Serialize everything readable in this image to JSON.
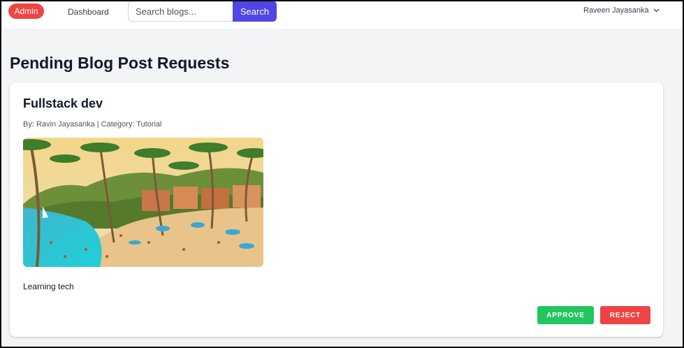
{
  "navbar": {
    "admin_badge": "Admin",
    "dashboard_link": "Dashboard",
    "search": {
      "placeholder": "Search blogs...",
      "value": "",
      "button_label": "Search"
    },
    "user_name": "Raveen Jayasanka",
    "user_menu_icon": "chevron-down-icon"
  },
  "page": {
    "title": "Pending Blog Post Requests"
  },
  "posts": [
    {
      "title": "Fullstack dev",
      "meta": "By: Ravin Jayasanka | Category: Tutorial",
      "image_alt": "tropical beach with palm trees",
      "body": "Learning tech",
      "approve_label": "APPROVE",
      "reject_label": "REJECT"
    }
  ],
  "colors": {
    "admin": "#ef4444",
    "search_button": "#4f46e5",
    "approve": "#22c55e",
    "reject": "#ef4444",
    "page_bg": "#f3f4f6"
  }
}
